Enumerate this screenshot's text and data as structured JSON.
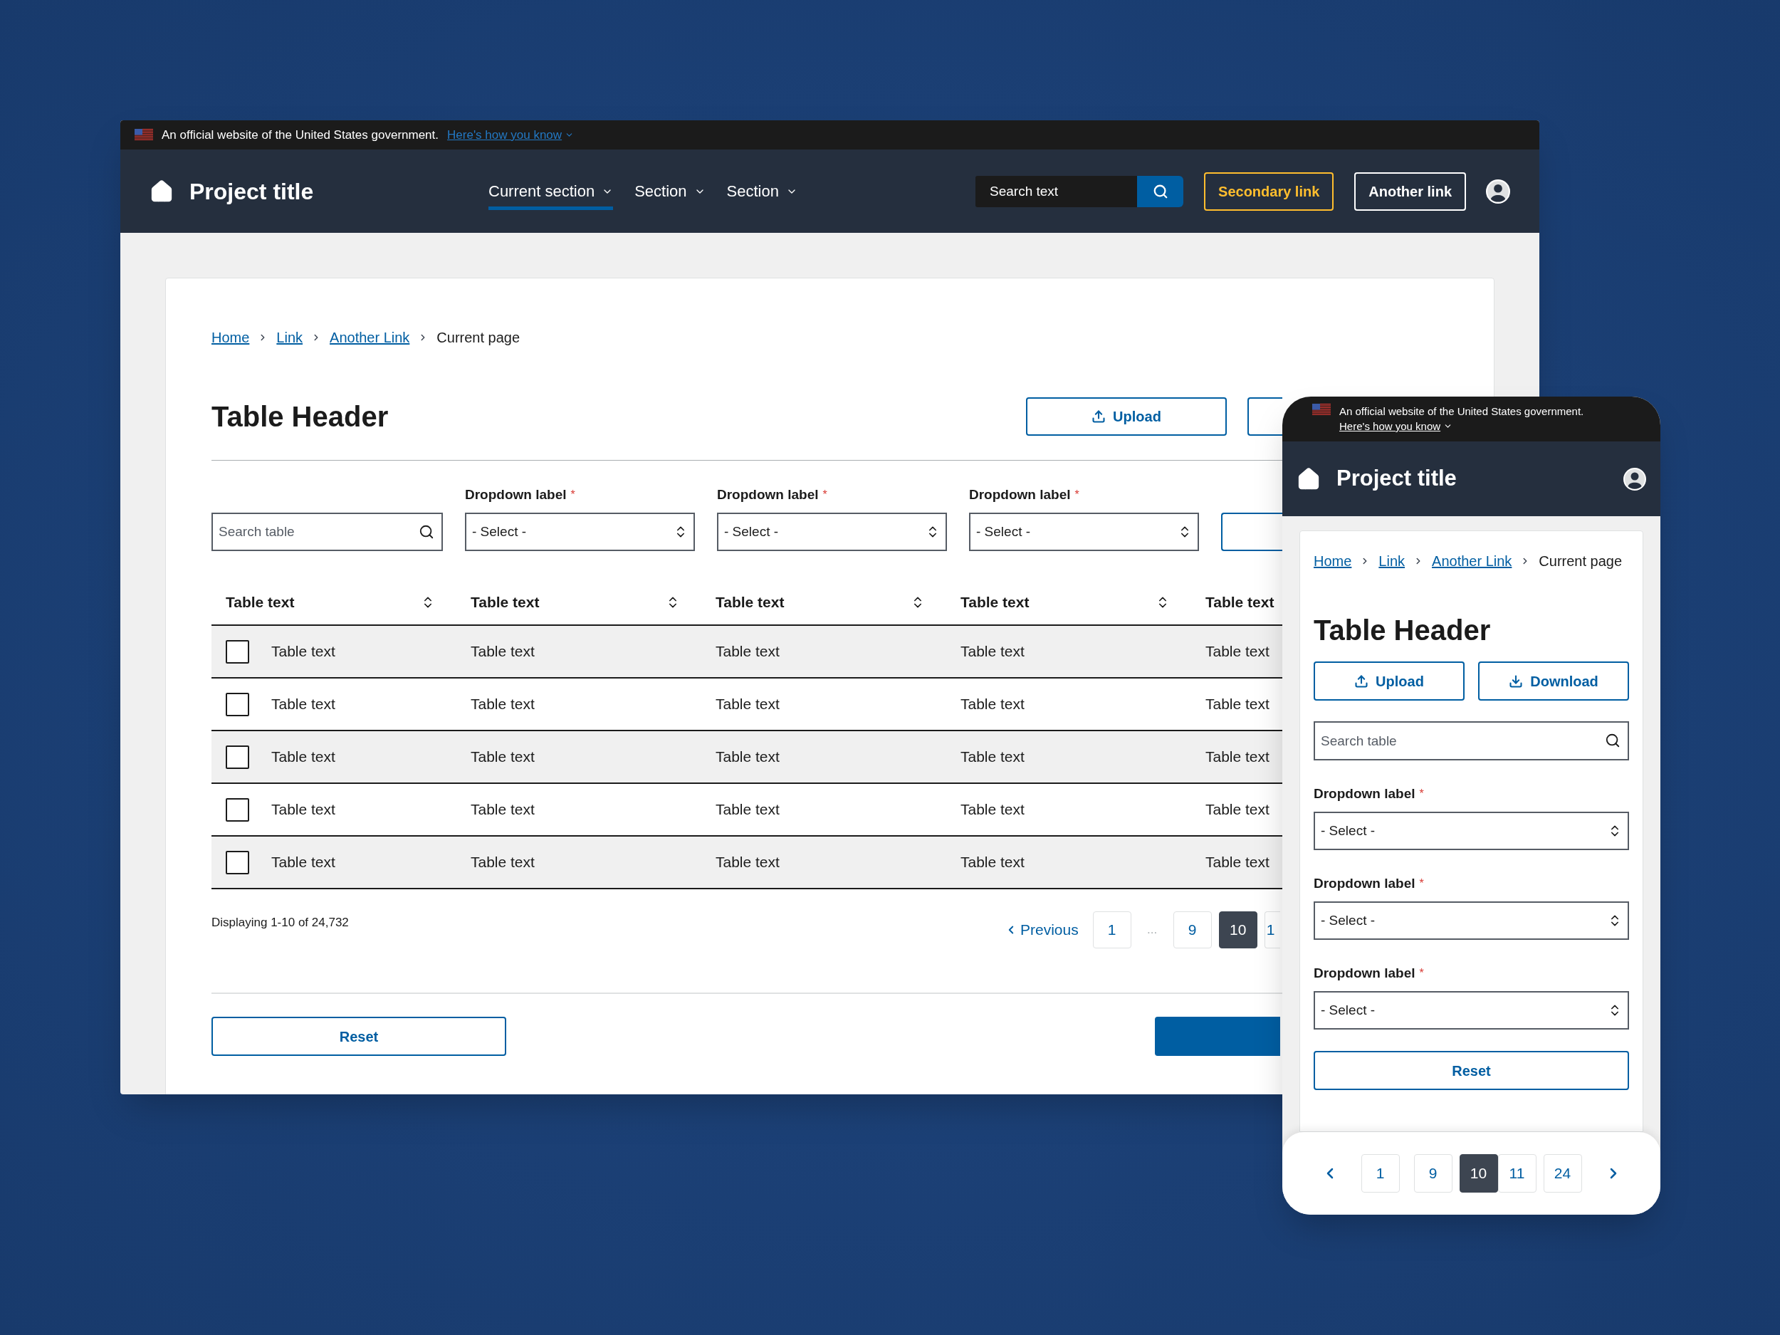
{
  "desktop": {
    "banner": {
      "text": "An official website of the United States government.",
      "link": "Here's how you know"
    },
    "header": {
      "title": "Project title",
      "nav": [
        {
          "label": "Current section",
          "selected": true
        },
        {
          "label": "Section",
          "selected": false
        },
        {
          "label": "Section",
          "selected": false
        }
      ],
      "search": {
        "placeholder": "Search text"
      },
      "links": [
        {
          "label": "Secondary link",
          "kind": "secondary"
        },
        {
          "label": "Another link",
          "kind": "outline"
        }
      ]
    },
    "breadcrumbs": [
      {
        "label": "Home",
        "kind": "link"
      },
      {
        "label": "Link",
        "kind": "link"
      },
      {
        "label": "Another Link",
        "kind": "link"
      },
      {
        "label": "Current page",
        "kind": "current"
      }
    ],
    "title": "Table Header",
    "upload": "Upload",
    "search": {
      "placeholder": "Search table"
    },
    "dropdowns": [
      {
        "label": "Dropdown label",
        "required_mark": "*",
        "value": "- Select -"
      },
      {
        "label": "Dropdown label",
        "required_mark": "*",
        "value": "- Select -"
      },
      {
        "label": "Dropdown label",
        "required_mark": "*",
        "value": "- Select -"
      }
    ],
    "table": {
      "columns": [
        "Table text",
        "Table text",
        "Table text",
        "Table text",
        "Table text"
      ],
      "rows": [
        {
          "checked": false,
          "cells": [
            "Table text",
            "Table text",
            "Table text",
            "Table text",
            "Table text"
          ]
        },
        {
          "checked": false,
          "cells": [
            "Table text",
            "Table text",
            "Table text",
            "Table text",
            "Table text"
          ]
        },
        {
          "checked": false,
          "cells": [
            "Table text",
            "Table text",
            "Table text",
            "Table text",
            "Table text"
          ]
        },
        {
          "checked": false,
          "cells": [
            "Table text",
            "Table text",
            "Table text",
            "Table text",
            "Table text"
          ]
        },
        {
          "checked": false,
          "cells": [
            "Table text",
            "Table text",
            "Table text",
            "Table text",
            "Table text"
          ]
        }
      ]
    },
    "summary": "Displaying 1-10 of 24,732",
    "previous": "Previous",
    "pages": [
      {
        "label": "1",
        "kind": "page",
        "selected": false
      },
      {
        "label": "...",
        "kind": "ellipsis"
      },
      {
        "label": "9",
        "kind": "page",
        "selected": false
      },
      {
        "label": "10",
        "kind": "page",
        "selected": true
      },
      {
        "label": "1",
        "kind": "cut",
        "selected": false
      }
    ],
    "reset": "Reset"
  },
  "mobile": {
    "banner": {
      "text": "An official website of the United States government.",
      "link": "Here's how you know"
    },
    "title": "Project title",
    "breadcrumbs": [
      {
        "label": "Home",
        "kind": "link"
      },
      {
        "label": "Link",
        "kind": "link"
      },
      {
        "label": "Another Link",
        "kind": "link"
      },
      {
        "label": "Current page",
        "kind": "current"
      }
    ],
    "heading": "Table Header",
    "actions": [
      {
        "label": "Upload",
        "kind": "upload"
      },
      {
        "label": "Download",
        "kind": "download"
      }
    ],
    "search": {
      "placeholder": "Search table"
    },
    "dropdowns": [
      {
        "label": "Dropdown label",
        "required_mark": "*",
        "value": "- Select -"
      },
      {
        "label": "Dropdown label",
        "required_mark": "*",
        "value": "- Select -"
      },
      {
        "label": "Dropdown label",
        "required_mark": "*",
        "value": "- Select -"
      }
    ],
    "reset": "Reset",
    "pages": [
      {
        "label": "1",
        "selected": false
      },
      {
        "label": "9",
        "selected": false
      },
      {
        "label": "10",
        "selected": true
      },
      {
        "label": "11",
        "selected": false
      },
      {
        "label": "24",
        "selected": false
      }
    ]
  }
}
